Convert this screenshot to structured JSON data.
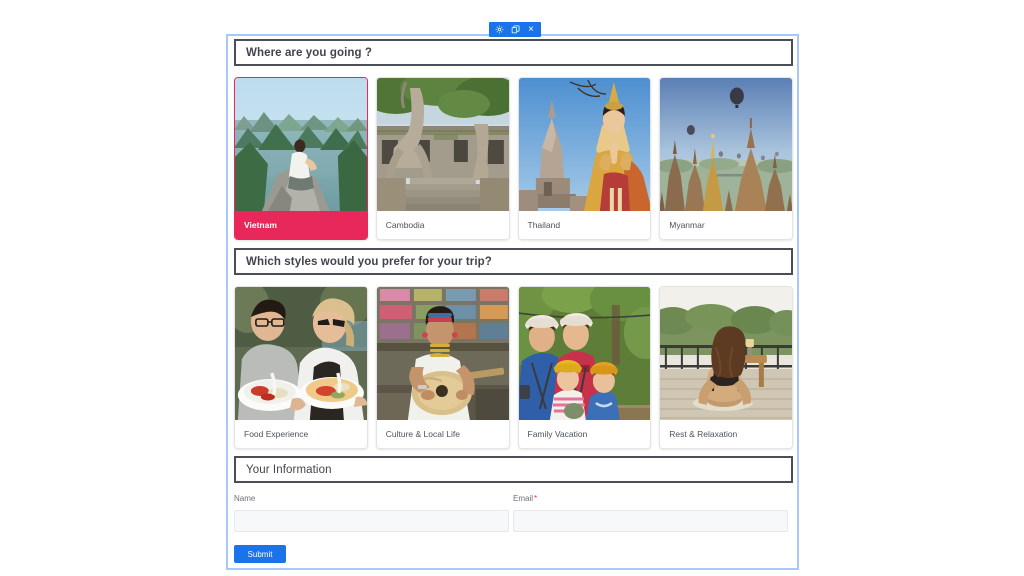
{
  "toolbar": {
    "settings_label": "settings-gear",
    "duplicate_label": "duplicate-block",
    "close_label": "×"
  },
  "sections": [
    {
      "id": "destination",
      "title": "Where are you going ?",
      "bold": true,
      "cards": [
        {
          "label": "Vietnam",
          "selected": true,
          "art": "halong-bay"
        },
        {
          "label": "Cambodia",
          "selected": false,
          "art": "angkor-wat"
        },
        {
          "label": "Thailand",
          "selected": false,
          "art": "thai-dancer"
        },
        {
          "label": "Myanmar",
          "selected": false,
          "art": "bagan-balloons"
        }
      ]
    },
    {
      "id": "styles",
      "title": "Which styles would you prefer for your trip?",
      "bold": true,
      "cards": [
        {
          "label": "Food Experience",
          "selected": false,
          "art": "couple-food"
        },
        {
          "label": "Culture & Local Life",
          "selected": false,
          "art": "local-musician"
        },
        {
          "label": "Family Vacation",
          "selected": false,
          "art": "family-helmets"
        },
        {
          "label": "Rest & Relaxation",
          "selected": false,
          "art": "yoga-deck"
        }
      ]
    },
    {
      "id": "info",
      "title": "Your Information",
      "bold": false,
      "cards": []
    }
  ],
  "form": {
    "name_label": "Name",
    "name_value": "",
    "email_label": "Email",
    "email_required_marker": "*",
    "email_value": "",
    "submit_label": "Submit"
  },
  "colors": {
    "selected_accent": "#e8285a",
    "submit_blue": "#1a73e8",
    "frame_border": "#a8c7fa",
    "header_border": "#4a4f57",
    "required_red": "#e53935"
  }
}
